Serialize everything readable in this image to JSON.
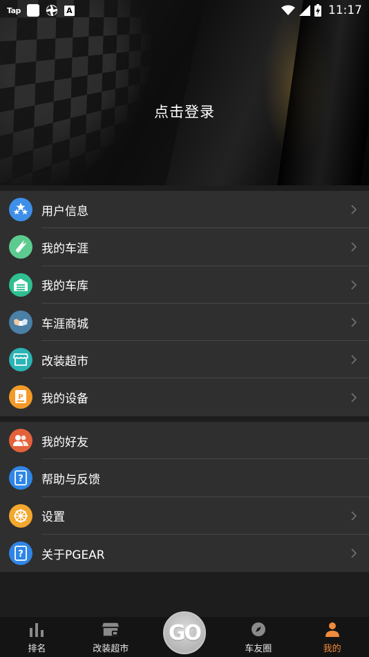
{
  "status_bar": {
    "left_icons": [
      "tap-logo",
      "square-app-icon",
      "aperture-icon",
      "a-app-icon"
    ],
    "tap_text": "Tap",
    "a_text": "A",
    "right_icons": [
      "wifi-icon",
      "signal-icon",
      "battery-charging-icon"
    ],
    "time": "11:17"
  },
  "header": {
    "login_text": "点击登录"
  },
  "menu_group_1": [
    {
      "label": "用户信息",
      "icon": "stars-icon",
      "color": "#3d8fe8",
      "chevron": true
    },
    {
      "label": "我的车涯",
      "icon": "wrench-icon",
      "color": "#5dcb8f",
      "chevron": true
    },
    {
      "label": "我的车库",
      "icon": "garage-icon",
      "color": "#2fbf91",
      "chevron": true
    },
    {
      "label": "车涯商城",
      "icon": "hands-icon",
      "color": "#4a7fa6",
      "chevron": true
    },
    {
      "label": "改装超市",
      "icon": "store-icon",
      "color": "#2cb3b5",
      "chevron": true
    },
    {
      "label": "我的设备",
      "icon": "device-icon",
      "color": "#f39a28",
      "chevron": true
    }
  ],
  "menu_group_2": [
    {
      "label": "我的好友",
      "icon": "friends-icon",
      "color": "#e4623a",
      "chevron": false
    },
    {
      "label": "帮助与反馈",
      "icon": "help-icon",
      "color": "#2f86e6",
      "chevron": false
    },
    {
      "label": "设置",
      "icon": "gear-icon",
      "color": "#f3a72e",
      "chevron": true
    },
    {
      "label": "关于PGEAR",
      "icon": "help-icon",
      "color": "#2f86e6",
      "chevron": true
    }
  ],
  "bottom_nav": {
    "items": [
      {
        "label": "排名",
        "icon": "ranking-icon",
        "active": false
      },
      {
        "label": "改装超市",
        "icon": "store-icon",
        "active": false
      },
      {
        "label": "车友圈",
        "icon": "compass-icon",
        "active": false
      },
      {
        "label": "我的",
        "icon": "person-icon",
        "active": true
      }
    ],
    "go_label": "GO",
    "active_color": "#f08a3c"
  }
}
